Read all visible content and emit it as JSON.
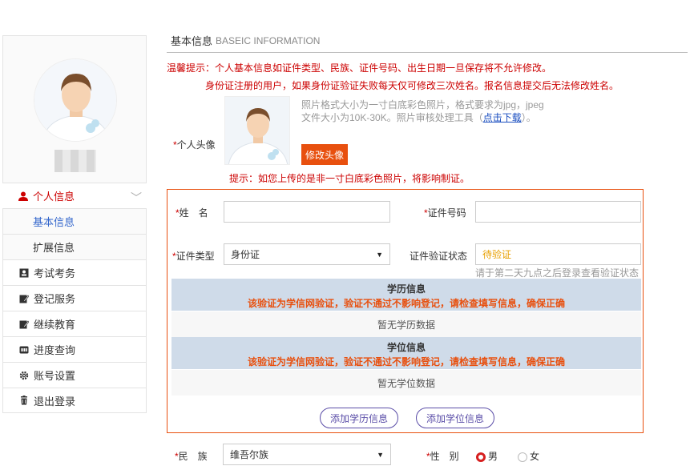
{
  "sidebar": {
    "menu": [
      {
        "label": "个人信息",
        "icon": "user-icon",
        "active": true
      },
      {
        "label": "考试考务",
        "icon": "id-card-icon"
      },
      {
        "label": "登记服务",
        "icon": "edit-icon"
      },
      {
        "label": "继续教育",
        "icon": "edit-icon"
      },
      {
        "label": "进度查询",
        "icon": "progress-icon"
      },
      {
        "label": "账号设置",
        "icon": "gear-icon"
      },
      {
        "label": "退出登录",
        "icon": "trash-icon"
      }
    ],
    "submenu": [
      {
        "label": "基本信息",
        "selected": true
      },
      {
        "label": "扩展信息"
      }
    ]
  },
  "main": {
    "section_title": "基本信息",
    "section_title_en": "BASEIC INFORMATION",
    "notice_line1": "温馨提示：个人基本信息如证件类型、民族、证件号码、出生日期一旦保存将不允许修改。",
    "notice_line2": "身份证注册的用户，如果身份证验证失败每天仅可修改三次姓名。报名信息提交后无法修改姓名。",
    "photo": {
      "label": "个人头像",
      "tip1": "照片格式大小为一寸白底彩色照片，格式要求为jpg，jpeg",
      "tip2_prefix": "文件大小为10K-30K。照片审核处理工具（",
      "tip2_link": "点击下载",
      "tip2_suffix": "）。",
      "change_button": "修改头像",
      "warning": "提示：如您上传的是非一寸白底彩色照片，将影响制证。"
    },
    "form": {
      "name_label": "姓　名",
      "name_value": "",
      "id_number_label": "证件号码",
      "id_number_value": "",
      "id_type_label": "证件类型",
      "id_type_value": "身份证",
      "verify_status_label": "证件验证状态",
      "verify_status_value": "待验证",
      "verify_note": "请于第二天九点之后登录查看验证状态",
      "education_title": "学历信息",
      "education_sub": "该验证为学信网验证，验证不通过不影响登记，请检查填写信息，确保正确",
      "education_empty": "暂无学历数据",
      "degree_title": "学位信息",
      "degree_sub": "该验证为学信网验证，验证不通过不影响登记，请检查填写信息，确保正确",
      "degree_empty": "暂无学位数据",
      "add_education_button": "添加学历信息",
      "add_degree_button": "添加学位信息"
    },
    "ethnicity_label": "民　族",
    "ethnicity_value": "维吾尔族",
    "gender_label": "性　别",
    "gender_options": [
      "男",
      "女"
    ],
    "gender_selected": "男"
  },
  "colors": {
    "accent": "#e8500f",
    "warning_text": "#cc0000",
    "band": "#cfdbe9",
    "link": "#1a4ec0"
  }
}
